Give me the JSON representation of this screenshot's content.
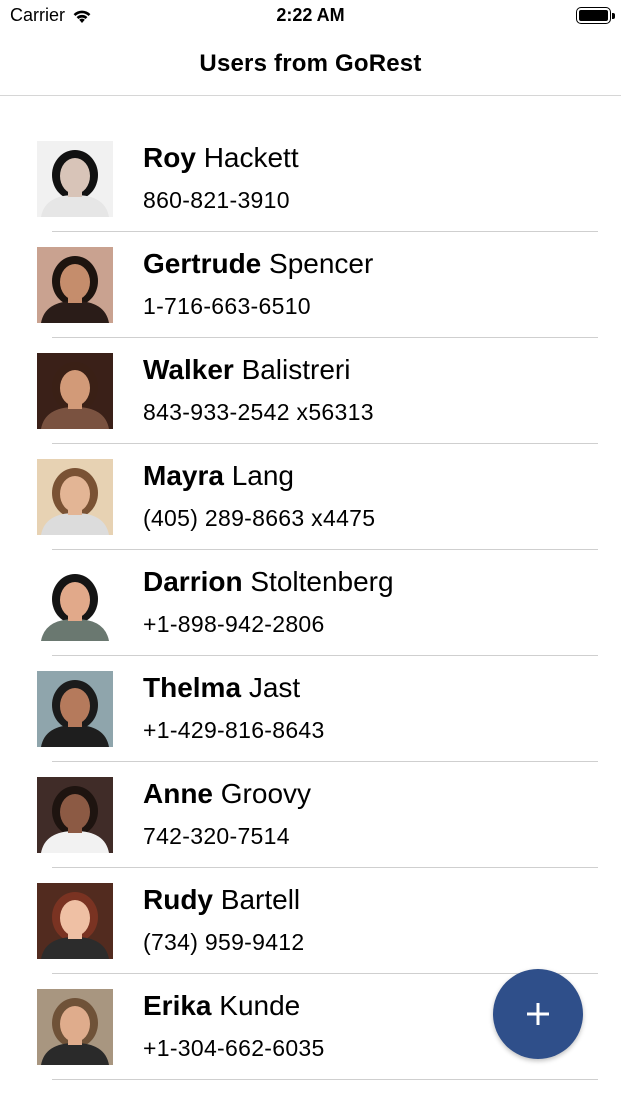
{
  "status_bar": {
    "carrier": "Carrier",
    "time": "2:22 AM",
    "battery_level": 1.0
  },
  "nav": {
    "title": "Users from GoRest"
  },
  "users": [
    {
      "first": "Roy",
      "last": "Hackett",
      "phone": "860-821-3910",
      "avatar": {
        "bg": "#f1f1f1",
        "hair": "#111111",
        "skin": "#d8c4b8",
        "shirt": "#e6e6e6"
      }
    },
    {
      "first": "Gertrude",
      "last": "Spencer",
      "phone": "1-716-663-6510",
      "avatar": {
        "bg": "#c9a290",
        "hair": "#1d140f",
        "skin": "#c58d6c",
        "shirt": "#2a1c18"
      }
    },
    {
      "first": "Walker",
      "last": "Balistreri",
      "phone": "843-933-2542 x56313",
      "avatar": {
        "bg": "#3a2018",
        "hair": "#3a2016",
        "skin": "#d29a78",
        "shirt": "#7a5240"
      }
    },
    {
      "first": "Mayra",
      "last": "Lang",
      "phone": "(405) 289-8663 x4475",
      "avatar": {
        "bg": "#e7d2b3",
        "hair": "#7a5234",
        "skin": "#e3b595",
        "shirt": "#dcdcdc"
      }
    },
    {
      "first": "Darrion",
      "last": "Stoltenberg",
      "phone": "+1-898-942-2806",
      "avatar": {
        "bg": "#ffffff",
        "hair": "#141414",
        "skin": "#e1a98a",
        "shirt": "#6a7870"
      }
    },
    {
      "first": "Thelma",
      "last": "Jast",
      "phone": "+1-429-816-8643",
      "avatar": {
        "bg": "#8fa5ac",
        "hair": "#1b1b1b",
        "skin": "#b57a5c",
        "shirt": "#1e1e1e"
      }
    },
    {
      "first": "Anne",
      "last": "Groovy",
      "phone": "742-320-7514",
      "avatar": {
        "bg": "#402c28",
        "hair": "#1e1410",
        "skin": "#8c5a44",
        "shirt": "#f2f2f2"
      }
    },
    {
      "first": "Rudy",
      "last": "Bartell",
      "phone": "(734) 959-9412",
      "avatar": {
        "bg": "#522b1f",
        "hair": "#7a3322",
        "skin": "#efc0a4",
        "shirt": "#2c2c2c"
      }
    },
    {
      "first": "Erika",
      "last": "Kunde",
      "phone": "+1-304-662-6035",
      "avatar": {
        "bg": "#a89680",
        "hair": "#6f5238",
        "skin": "#dfac8c",
        "shirt": "#2a2a2a"
      }
    }
  ],
  "fab": {
    "color": "#2f4f8a",
    "icon": "plus-icon"
  }
}
